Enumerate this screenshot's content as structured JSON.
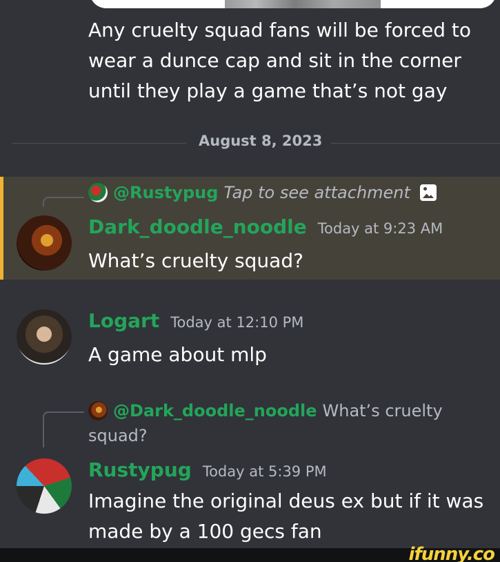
{
  "messages_above": {
    "text": "Any cruelty squad fans will be forced to\nwear a dunce cap and sit in the corner\nuntil they play a game that’s not gay"
  },
  "date_divider": {
    "label": "August 8, 2023"
  },
  "message_1": {
    "reply": {
      "mention": "@Rustypug",
      "preview": "Tap to see attachment",
      "icon": "image-icon"
    },
    "username": "Dark_doodle_noodle",
    "timestamp": "Today at 9:23 AM",
    "text": "What’s cruelty squad?",
    "highlight_color": "#f0b232"
  },
  "message_2": {
    "username": "Logart",
    "timestamp": "Today at 12:10 PM",
    "text": "A game about mlp"
  },
  "message_3": {
    "reply": {
      "mention": "@Dark_doodle_noodle",
      "preview": "What’s cruelty",
      "preview_cont": "squad?"
    },
    "username": "Rustypug",
    "timestamp": "Today at 5:39 PM",
    "text": "Imagine the original deus ex but if it was\nmade by a 100 gecs fan"
  },
  "watermark": "ifunny.co",
  "colors": {
    "background": "#313338",
    "username_green": "#23a55a",
    "highlight_bg": "#45423a"
  }
}
